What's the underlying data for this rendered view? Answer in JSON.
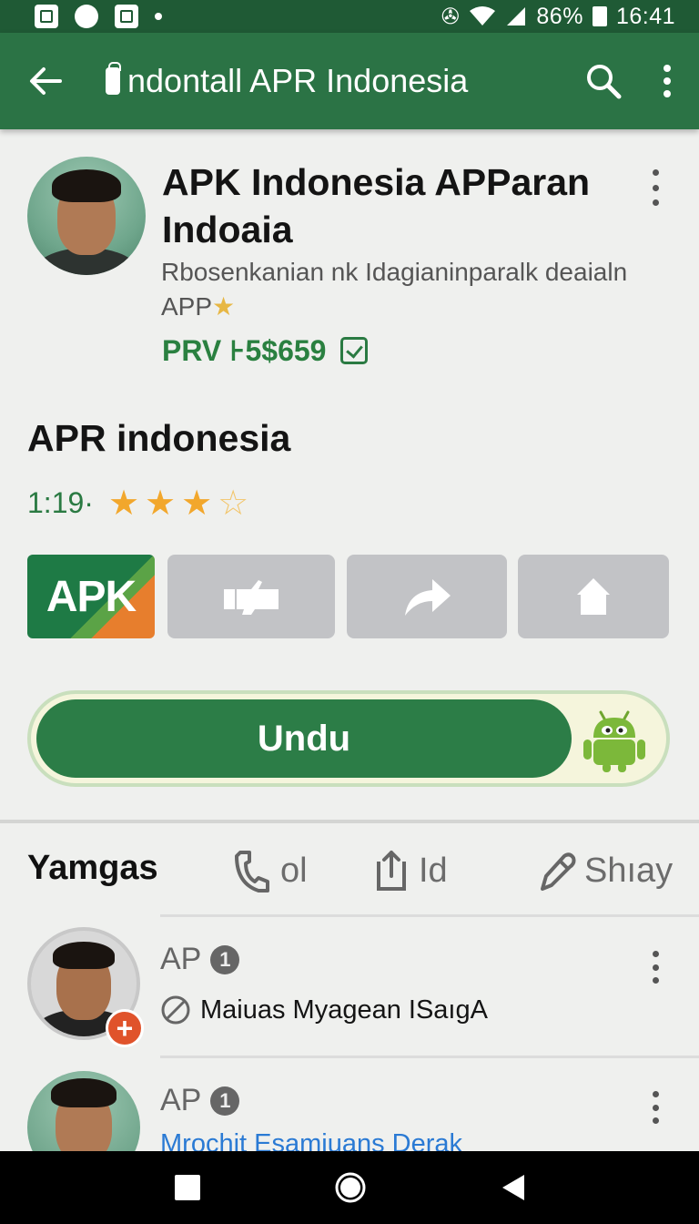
{
  "status_bar": {
    "battery_percent": "86%",
    "time": "16:41",
    "icons": [
      "gallery-icon",
      "shield-icon",
      "notification-icon",
      "dot-icon",
      "vibrate-icon",
      "wifi-icon",
      "signal-icon",
      "battery-icon"
    ]
  },
  "app_bar": {
    "title": "ndontall APR Indonesia",
    "back_icon": "arrow-left-icon",
    "search_icon": "search-icon",
    "menu_icon": "more-vert-icon"
  },
  "app": {
    "title": "APK Indonesia APParan Indoaia",
    "description": "Rbosenkanian nk Idagianinparalk deaialn APP",
    "price": "PRV ⊦5$659"
  },
  "section": {
    "title": "APR indonesia",
    "rating": "1:19·",
    "stars": 3.5,
    "star_max": 5
  },
  "buttons": {
    "apk_label": "APK",
    "like_icon": "thumb-icon",
    "share_icon": "share-icon",
    "home_icon": "home-icon"
  },
  "download": {
    "label": "Undu",
    "badge_icon": "android-icon"
  },
  "tabs": [
    {
      "label": "Yamgas",
      "icon": ""
    },
    {
      "label": "ol",
      "icon": "phone-icon"
    },
    {
      "label": "Id",
      "icon": "upload-icon"
    },
    {
      "label": "Shıay",
      "icon": "pen-icon"
    }
  ],
  "list": [
    {
      "title": "AP",
      "badge": "1",
      "subtitle": "Maiuas Myagean ISaıgA",
      "subtitle_icon": "no-entry-icon"
    },
    {
      "title": "AP",
      "badge": "1",
      "subtitle": "Mrochit Esamiuans Derak"
    }
  ],
  "colors": {
    "status_bar": "#1f5a35",
    "app_bar": "#2b7345",
    "accent": "#2c7d47",
    "star": "#f2a72c",
    "link": "#2a7ad4"
  }
}
